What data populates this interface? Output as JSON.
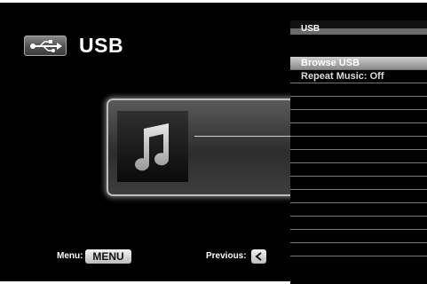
{
  "header": {
    "title": "USB",
    "icon": "usb-icon"
  },
  "now_playing": {
    "art_icon": "music-note-icon"
  },
  "hints": {
    "menu_label": "Menu:",
    "menu_key": "MENU",
    "previous_label": "Previous:",
    "previous_icon": "chevron-left-icon"
  },
  "side_menu": {
    "title": "USB",
    "items": [
      {
        "label": "Browse USB",
        "selected": true
      },
      {
        "label": "Repeat Music: Off",
        "selected": false
      },
      {
        "label": "",
        "selected": false
      },
      {
        "label": "",
        "selected": false
      },
      {
        "label": "",
        "selected": false
      },
      {
        "label": "",
        "selected": false
      },
      {
        "label": "",
        "selected": false
      },
      {
        "label": "",
        "selected": false
      },
      {
        "label": "",
        "selected": false
      },
      {
        "label": "",
        "selected": false
      },
      {
        "label": "",
        "selected": false
      },
      {
        "label": "",
        "selected": false
      },
      {
        "label": "",
        "selected": false
      },
      {
        "label": "",
        "selected": false
      },
      {
        "label": "",
        "selected": false
      }
    ]
  },
  "colors": {
    "background": "#000000",
    "text": "#ffffff",
    "selected_row": "#a8a8a8"
  }
}
